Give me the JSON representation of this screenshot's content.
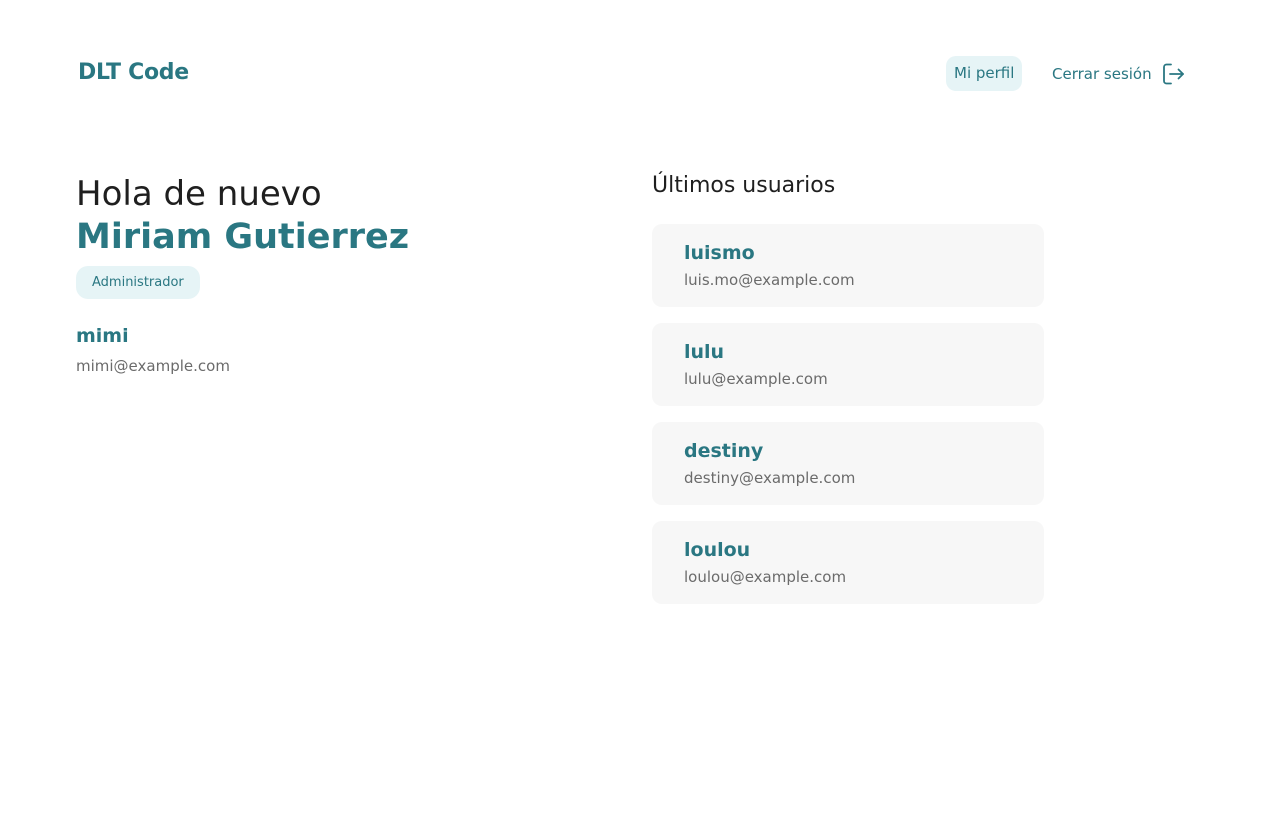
{
  "header": {
    "logo": "DLT Code",
    "nav": {
      "profile_label": "Mi perfil",
      "logout_label": "Cerrar sesión"
    }
  },
  "profile": {
    "greeting": "Hola de nuevo",
    "full_name": "Miriam Gutierrez",
    "role": "Administrador",
    "username": "mimi",
    "email": "mimi@example.com"
  },
  "recent_users": {
    "title": "Últimos usuarios",
    "items": [
      {
        "username": "luismo",
        "email": "luis.mo@example.com"
      },
      {
        "username": "lulu",
        "email": "lulu@example.com"
      },
      {
        "username": "destiny",
        "email": "destiny@example.com"
      },
      {
        "username": "loulou",
        "email": "loulou@example.com"
      }
    ]
  },
  "colors": {
    "brand": "#2a7782",
    "badge_bg": "#e6f4f6",
    "card_bg": "#f7f7f7",
    "text_primary": "#1f1f1f",
    "text_muted": "#6b6b6b"
  }
}
